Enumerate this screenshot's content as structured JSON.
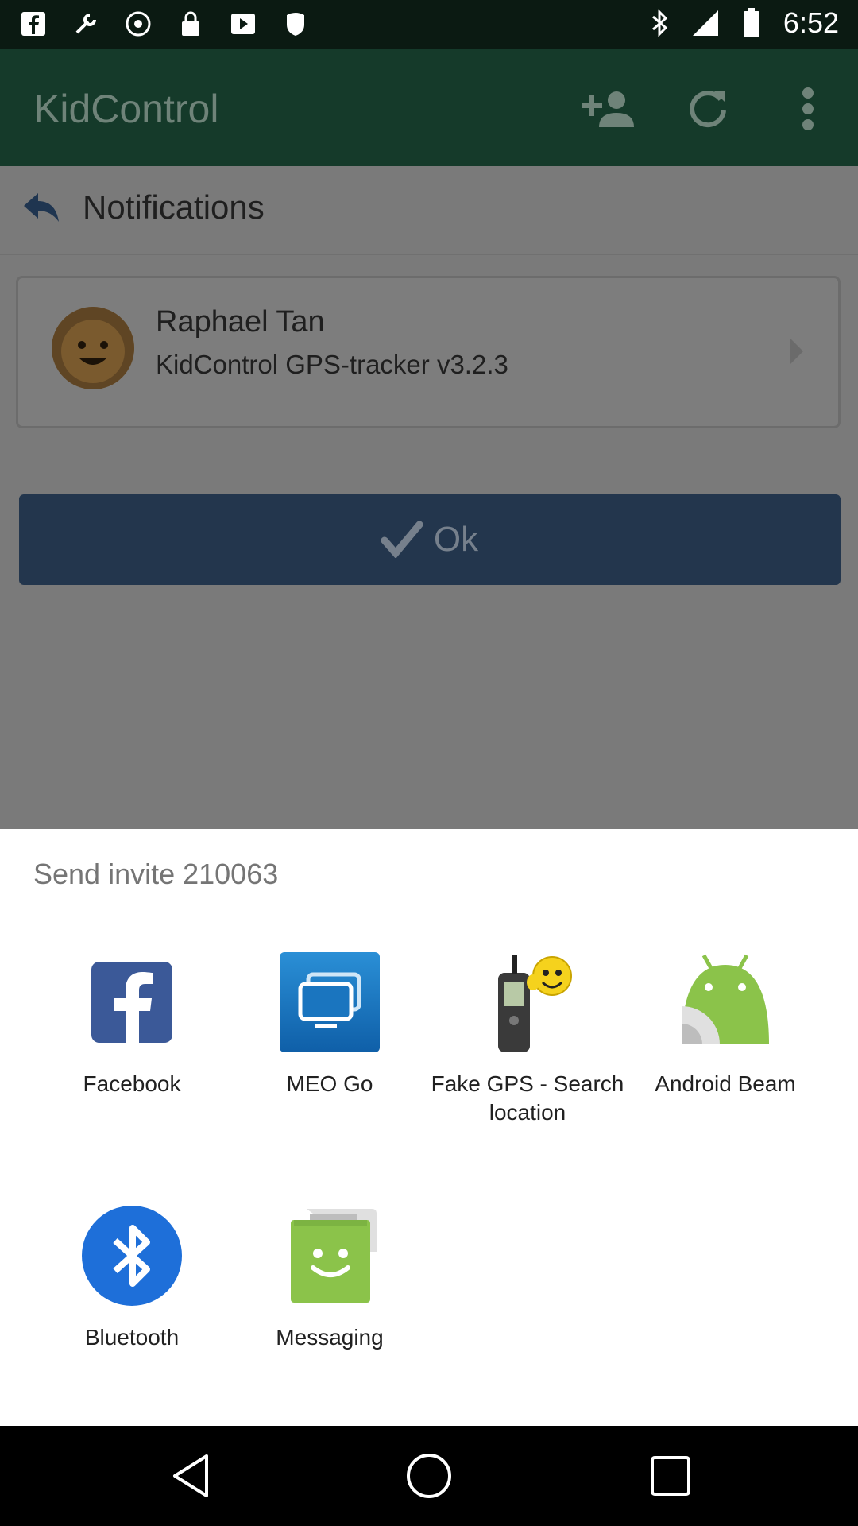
{
  "status_bar": {
    "time": "6:52",
    "left_icons": [
      "facebook-icon",
      "wrench-icon",
      "do-not-disturb-icon",
      "lock-icon",
      "play-store-icon",
      "shield-icon"
    ],
    "right_icons": [
      "bluetooth-icon",
      "signal-icon",
      "battery-icon"
    ]
  },
  "app_bar": {
    "title": "KidControl",
    "actions": [
      "add-person-icon",
      "refresh-icon",
      "more-vert-icon"
    ]
  },
  "notifications": {
    "header": "Notifications",
    "card": {
      "name": "Raphael Tan",
      "subtitle": "KidControl GPS-tracker v3.2.3"
    },
    "ok_button": "Ok"
  },
  "share_sheet": {
    "title": "Send invite 210063",
    "apps": [
      {
        "label": "Facebook",
        "icon": "facebook-icon"
      },
      {
        "label": "MEO Go",
        "icon": "meo-go-icon"
      },
      {
        "label": "Fake GPS - Search location",
        "icon": "fake-gps-icon"
      },
      {
        "label": "Android Beam",
        "icon": "android-beam-icon"
      },
      {
        "label": "Bluetooth",
        "icon": "bluetooth-icon"
      },
      {
        "label": "Messaging",
        "icon": "messaging-icon"
      }
    ]
  },
  "nav_bar": [
    "back-icon",
    "home-icon",
    "recents-icon"
  ],
  "colors": {
    "status_bar": "#0b1a12",
    "app_bar_dimmed": "#153a2a",
    "ok_button_dimmed": "#23364d",
    "facebook": "#3b5998",
    "bluetooth": "#1e6fd9",
    "android_green": "#8bc34a"
  }
}
